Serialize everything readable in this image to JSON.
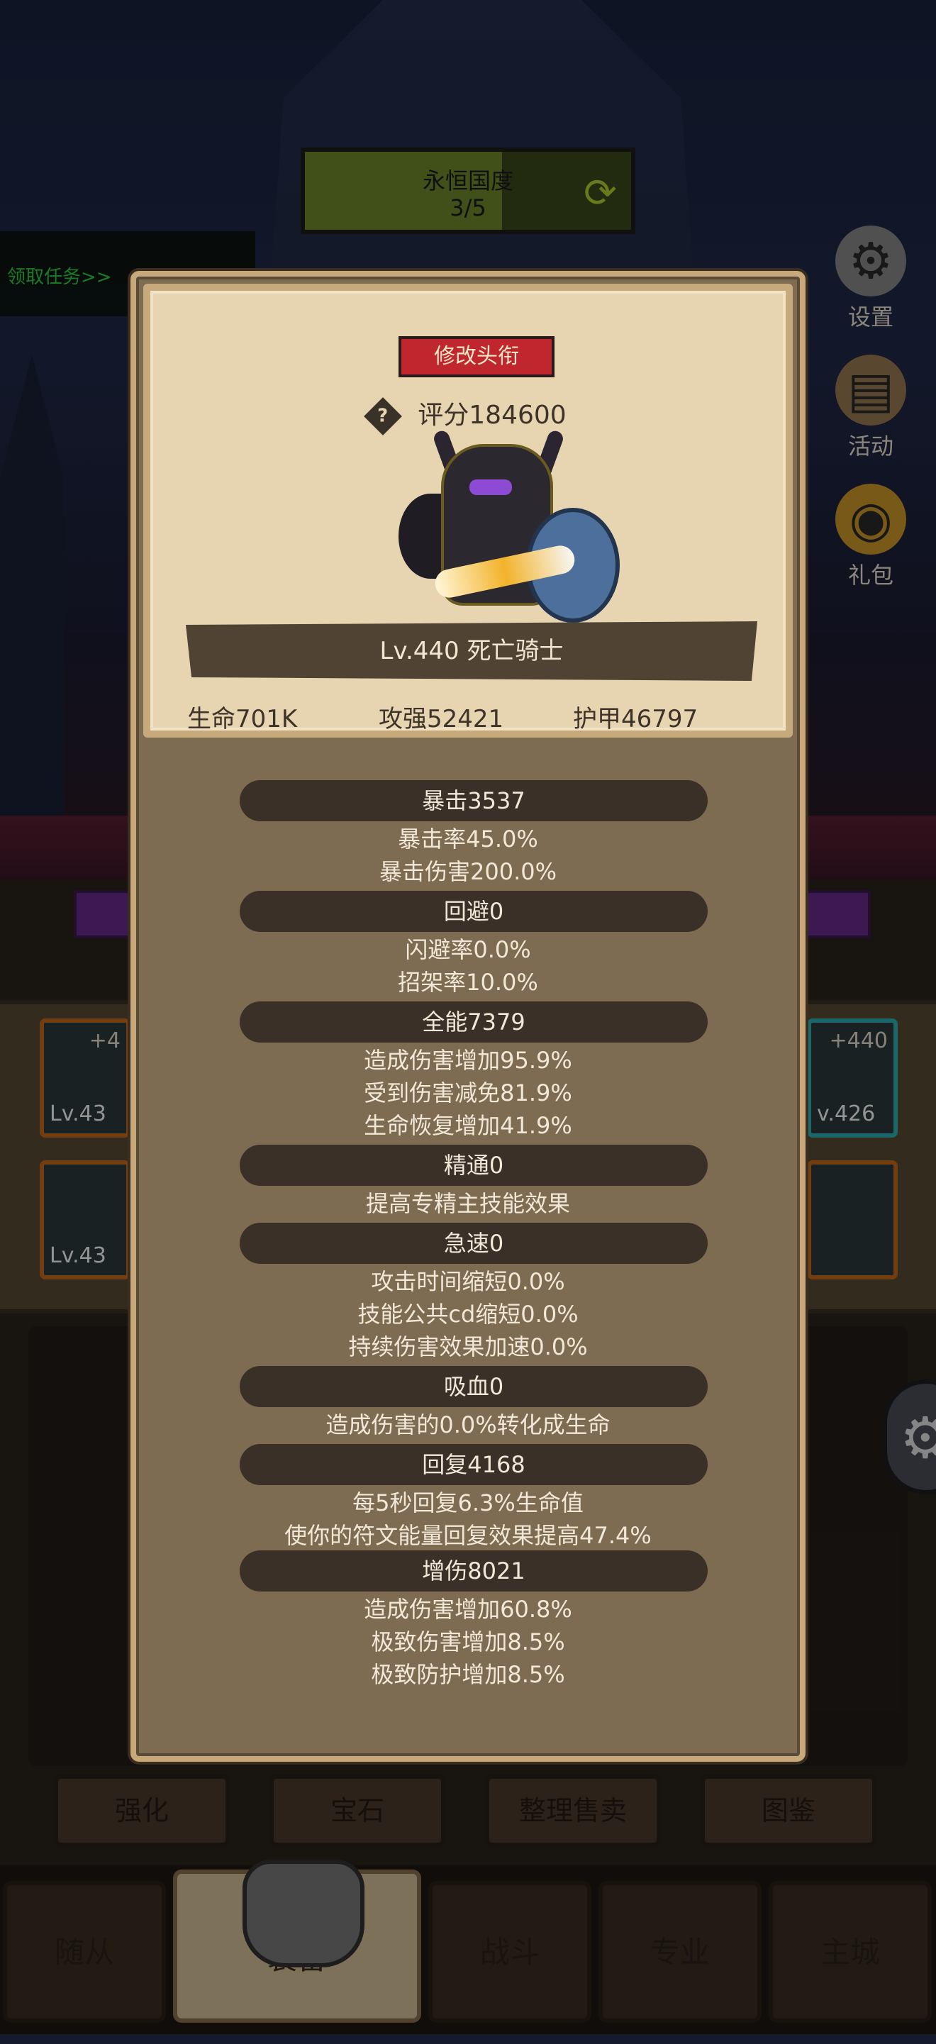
{
  "region": {
    "title": "永恒国度",
    "progress": "3/5"
  },
  "quest_tab": {
    "label": "领取任务>>"
  },
  "side_menu": [
    {
      "label": "设置",
      "icon": "gear-icon"
    },
    {
      "label": "活动",
      "icon": "scroll-icon"
    },
    {
      "label": "礼包",
      "icon": "pot-icon"
    }
  ],
  "equipment_slots": [
    {
      "level": "Lv.43",
      "plus": "+4"
    },
    {
      "level": "Lv.43",
      "plus": ""
    },
    {
      "level": "v.426",
      "plus": "+440"
    },
    {
      "level": "",
      "plus": ""
    }
  ],
  "sub_tabs": [
    "强化",
    "宝石",
    "整理售卖",
    "图鉴"
  ],
  "nav_tabs": [
    "随从",
    "装备",
    "战斗",
    "专业",
    "主城"
  ],
  "profile": {
    "title_button": "修改头衔",
    "score": "评分184600",
    "name_level": "Lv.440 死亡骑士",
    "stats": [
      "生命701K",
      "攻强52421",
      "护甲46797"
    ]
  },
  "sections": [
    {
      "header": "暴击3537",
      "lines": [
        "暴击率45.0%",
        "暴击伤害200.0%"
      ]
    },
    {
      "header": "回避0",
      "lines": [
        "闪避率0.0%",
        "招架率10.0%"
      ]
    },
    {
      "header": "全能7379",
      "lines": [
        "造成伤害增加95.9%",
        "受到伤害减免81.9%",
        "生命恢复增加41.9%"
      ]
    },
    {
      "header": "精通0",
      "lines": [
        "提高专精主技能效果"
      ]
    },
    {
      "header": "急速0",
      "lines": [
        "攻击时间缩短0.0%",
        "技能公共cd缩短0.0%",
        "持续伤害效果加速0.0%"
      ]
    },
    {
      "header": "吸血0",
      "lines": [
        "造成伤害的0.0%转化成生命"
      ]
    },
    {
      "header": "回复4168",
      "lines": [
        "每5秒回复6.3%生命值",
        "使你的符文能量回复效果提高47.4%"
      ]
    },
    {
      "header": "增伤8021",
      "lines": [
        "造成伤害增加60.8%",
        "极致伤害增加8.5%",
        "极致防护增加8.5%"
      ]
    }
  ],
  "colors": {
    "title_button": "#c0262e",
    "panel": "#7d6b52",
    "card": "#e7d4b1"
  }
}
